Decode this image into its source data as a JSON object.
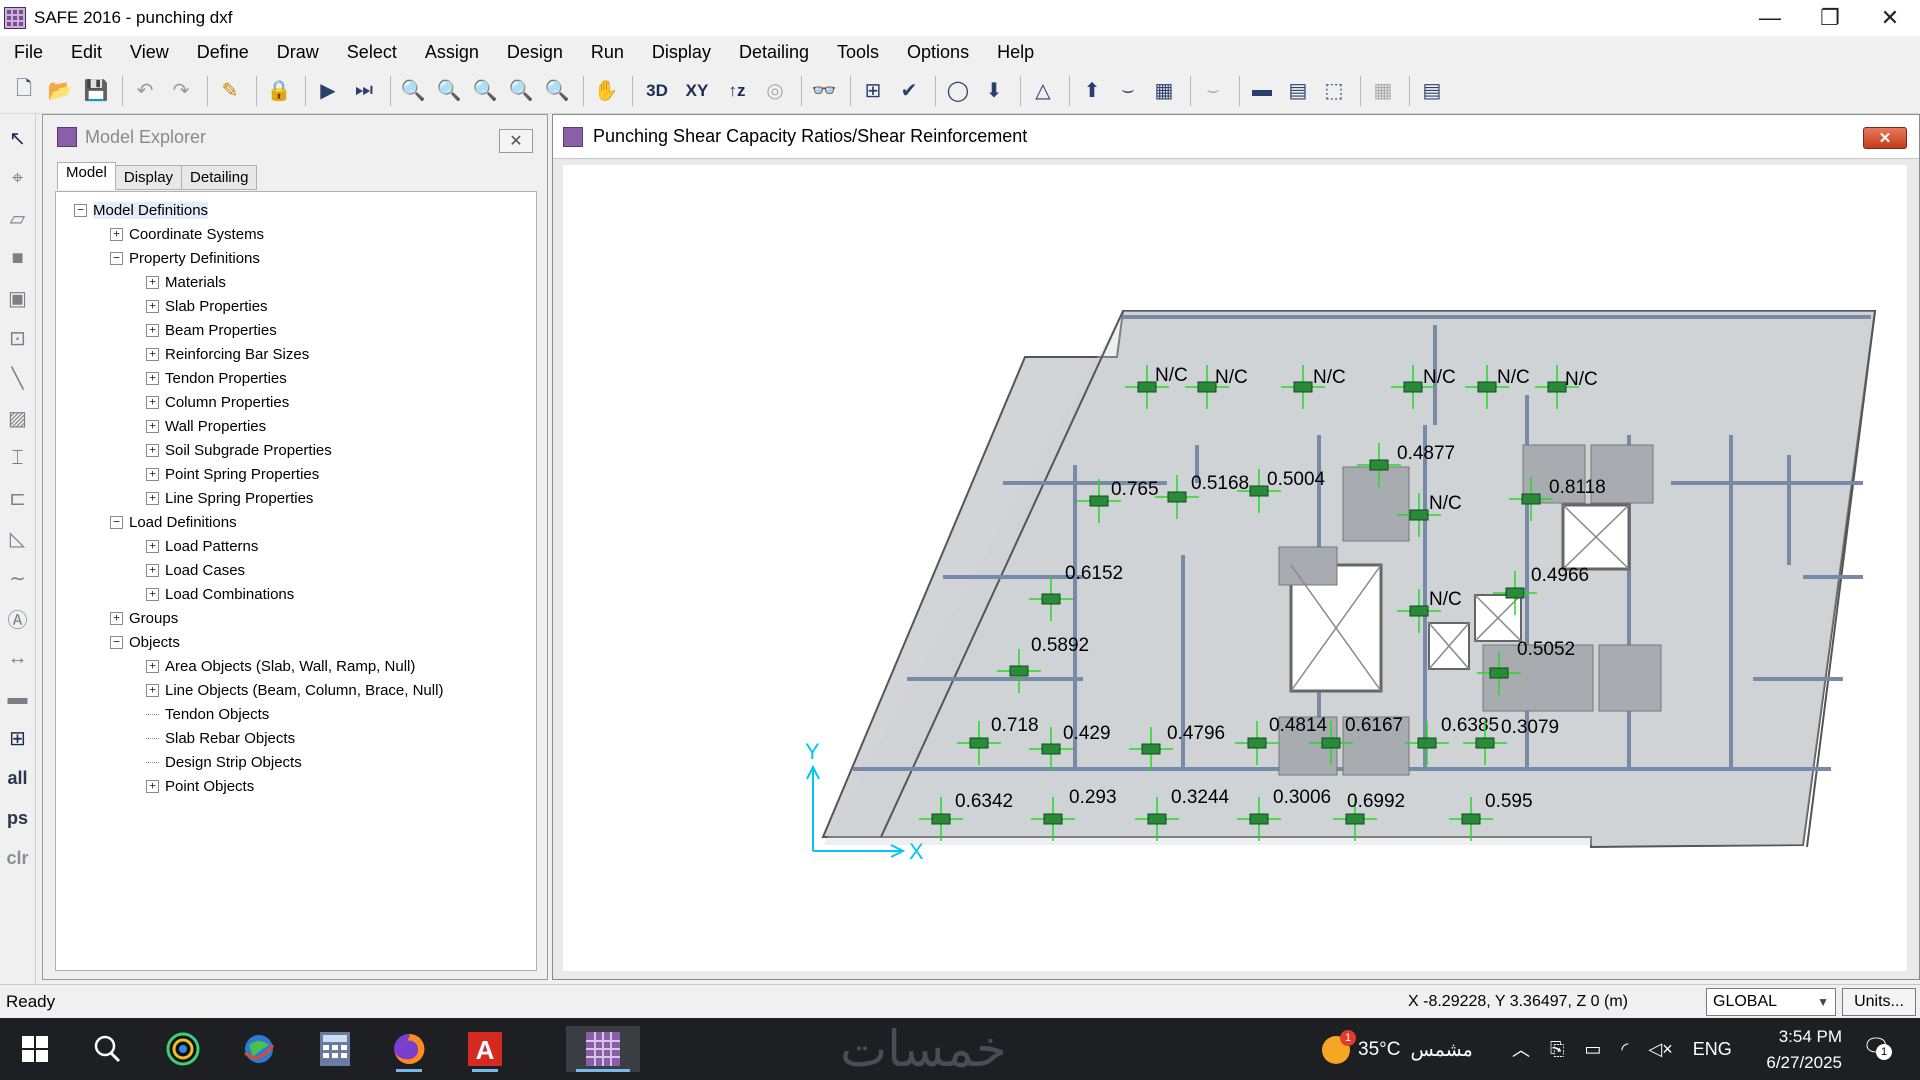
{
  "window": {
    "title": "SAFE 2016 - punching dxf",
    "minimize": "—",
    "maximize": "❐",
    "close": "✕"
  },
  "menu": [
    "File",
    "Edit",
    "View",
    "Define",
    "Draw",
    "Select",
    "Assign",
    "Design",
    "Run",
    "Display",
    "Detailing",
    "Tools",
    "Options",
    "Help"
  ],
  "toolbar": {
    "view_3d": "3D",
    "view_xy": "XY",
    "view_z": "↑z"
  },
  "left_tools": {
    "all": "all",
    "ps": "ps",
    "clr": "clr"
  },
  "explorer": {
    "title": "Model Explorer",
    "tabs": [
      "Model",
      "Display",
      "Detailing"
    ],
    "tree": [
      {
        "label": "Model Definitions",
        "level": 0,
        "toggle": "−",
        "selected": true
      },
      {
        "label": "Coordinate Systems",
        "level": 1,
        "toggle": "+"
      },
      {
        "label": "Property Definitions",
        "level": 1,
        "toggle": "−"
      },
      {
        "label": "Materials",
        "level": 2,
        "toggle": "+"
      },
      {
        "label": "Slab Properties",
        "level": 2,
        "toggle": "+"
      },
      {
        "label": "Beam Properties",
        "level": 2,
        "toggle": "+"
      },
      {
        "label": "Reinforcing Bar Sizes",
        "level": 2,
        "toggle": "+"
      },
      {
        "label": "Tendon Properties",
        "level": 2,
        "toggle": "+"
      },
      {
        "label": "Column Properties",
        "level": 2,
        "toggle": "+"
      },
      {
        "label": "Wall Properties",
        "level": 2,
        "toggle": "+"
      },
      {
        "label": "Soil Subgrade Properties",
        "level": 2,
        "toggle": "+"
      },
      {
        "label": "Point Spring Properties",
        "level": 2,
        "toggle": "+"
      },
      {
        "label": "Line Spring Properties",
        "level": 2,
        "toggle": "+"
      },
      {
        "label": "Load Definitions",
        "level": 1,
        "toggle": "−"
      },
      {
        "label": "Load Patterns",
        "level": 2,
        "toggle": "+"
      },
      {
        "label": "Load Cases",
        "level": 2,
        "toggle": "+"
      },
      {
        "label": "Load Combinations",
        "level": 2,
        "toggle": "+"
      },
      {
        "label": "Groups",
        "level": 1,
        "toggle": "+"
      },
      {
        "label": "Objects",
        "level": 1,
        "toggle": "−"
      },
      {
        "label": "Area Objects (Slab, Wall, Ramp, Null)",
        "level": 2,
        "toggle": "+"
      },
      {
        "label": "Line Objects (Beam, Column, Brace, Null)",
        "level": 2,
        "toggle": "+"
      },
      {
        "label": "Tendon Objects",
        "level": 2,
        "toggle": ""
      },
      {
        "label": "Slab Rebar Objects",
        "level": 2,
        "toggle": ""
      },
      {
        "label": "Design Strip Objects",
        "level": 2,
        "toggle": ""
      },
      {
        "label": "Point Objects",
        "level": 2,
        "toggle": "+"
      }
    ]
  },
  "drawing": {
    "title": "Punching Shear Capacity Ratios/Shear Reinforcement",
    "close": "✕",
    "axis_x": "X",
    "axis_y": "Y",
    "ratios": [
      "N/C",
      "N/C",
      "N/C",
      "N/C",
      "N/C",
      "N/C",
      "0.4877",
      "0.765",
      "0.5168",
      "0.5004",
      "N/C",
      "0.8118",
      "0.6152",
      "0.4966",
      "N/C",
      "0.5892",
      "0.5052",
      "0.718",
      "0.429",
      "0.4796",
      "0.4814",
      "0.6167",
      "0.6385",
      "0.3079",
      "0.6342",
      "0.293",
      "0.3244",
      "0.3006",
      "0.6992",
      "0.595"
    ]
  },
  "status": {
    "ready": "Ready",
    "coords": "X -8.29228,  Y 3.36497,  Z 0  (m)",
    "coord_system": "GLOBAL",
    "units": "Units..."
  },
  "taskbar": {
    "watermark": "خمسات",
    "temperature": "35°C",
    "weather_text": "مشمس",
    "weather_badge": "1",
    "language": "ENG",
    "time": "3:54 PM",
    "date": "6/27/2025",
    "notification_count": "1"
  }
}
